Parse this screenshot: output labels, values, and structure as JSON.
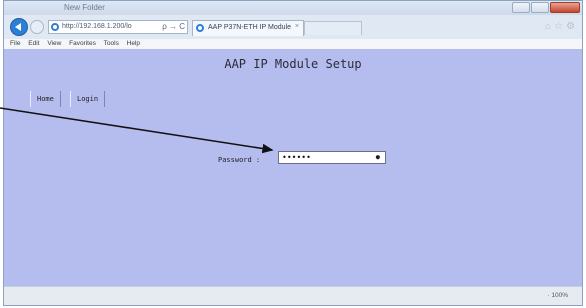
{
  "browser": {
    "window_title": "New Folder",
    "address_url": "http://192.168.1.200/lo",
    "address_controls": "ρ → C",
    "tab_title": "AAP P37N-ETH IP Module",
    "tab_close": "×",
    "menu": [
      "File",
      "Edit",
      "View",
      "Favorites",
      "Tools",
      "Help"
    ],
    "zoom": "· 100%"
  },
  "page": {
    "title": "AAP IP Module Setup",
    "nav": [
      {
        "label": "Home"
      },
      {
        "label": "Login"
      }
    ],
    "password_label": "Password :",
    "password_value": "••••••",
    "password_eye": "●"
  },
  "colors": {
    "page_bg": "#b5bdef",
    "chrome_bg": "#dfe8f3",
    "arrow": "#111111"
  }
}
